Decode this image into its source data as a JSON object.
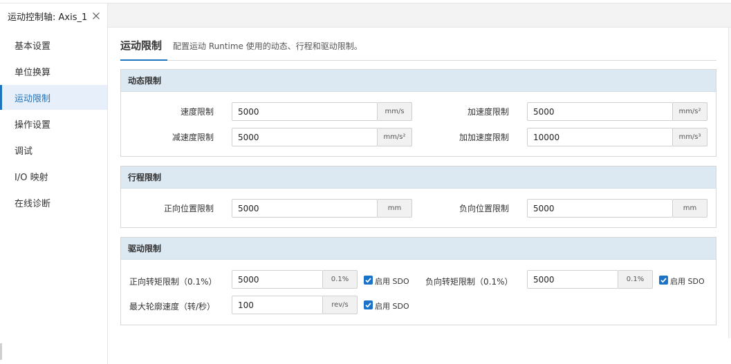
{
  "tab": {
    "title": "运动控制轴: Axis_1"
  },
  "sidebar": {
    "items": [
      {
        "label": "基本设置"
      },
      {
        "label": "单位换算"
      },
      {
        "label": "运动限制"
      },
      {
        "label": "操作设置"
      },
      {
        "label": "调试"
      },
      {
        "label": "I/O 映射"
      },
      {
        "label": "在线诊断"
      }
    ],
    "active_index": 2
  },
  "header": {
    "title": "运动限制",
    "description": "配置运动 Runtime 使用的动态、行程和驱动限制。"
  },
  "dynamic": {
    "title": "动态限制",
    "velocity": {
      "label": "速度限制",
      "value": "5000",
      "unit": "mm/s"
    },
    "acceleration": {
      "label": "加速度限制",
      "value": "5000",
      "unit": "mm/s²"
    },
    "deceleration": {
      "label": "减速度限制",
      "value": "5000",
      "unit": "mm/s²"
    },
    "jerk": {
      "label": "加加速度限制",
      "value": "10000",
      "unit": "mm/s³"
    }
  },
  "travel": {
    "title": "行程限制",
    "positive": {
      "label": "正向位置限制",
      "value": "5000",
      "unit": "mm"
    },
    "negative": {
      "label": "负向位置限制",
      "value": "5000",
      "unit": "mm"
    }
  },
  "drive": {
    "title": "驱动限制",
    "pos_torque": {
      "label": "正向转矩限制（0.1%）",
      "value": "5000",
      "unit": "0.1%",
      "sdo_label": "启用 SDO",
      "sdo_checked": true
    },
    "neg_torque": {
      "label": "负向转矩限制（0.1%）",
      "value": "5000",
      "unit": "0.1%",
      "sdo_label": "启用 SDO",
      "sdo_checked": true
    },
    "max_speed": {
      "label": "最大轮廓速度（转/秒）",
      "value": "100",
      "unit": "rev/s",
      "sdo_label": "启用 SDO",
      "sdo_checked": true
    }
  },
  "colors": {
    "accent": "#1e73be",
    "section_header": "#dce9f3",
    "checkbox": "#1a73c8"
  }
}
